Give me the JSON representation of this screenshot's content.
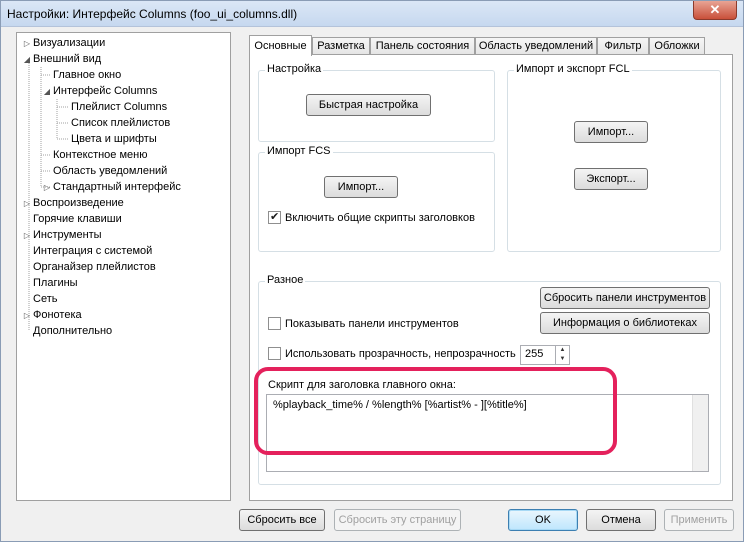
{
  "window": {
    "title": "Настройки: Интерфейс Columns (foo_ui_columns.dll)",
    "close_label": "✕"
  },
  "tree": {
    "items": [
      {
        "label": "Визуализации",
        "arrow": "▷"
      },
      {
        "label": "Внешний вид",
        "arrow": "◢"
      },
      {
        "label": "Главное окно",
        "arrow": ""
      },
      {
        "label": "Интерфейс Columns",
        "arrow": "◢"
      },
      {
        "label": "Плейлист Columns",
        "arrow": ""
      },
      {
        "label": "Список плейлистов",
        "arrow": ""
      },
      {
        "label": "Цвета и шрифты",
        "arrow": ""
      },
      {
        "label": "Контекстное меню",
        "arrow": ""
      },
      {
        "label": "Область уведомлений",
        "arrow": ""
      },
      {
        "label": "Стандартный интерфейс",
        "arrow": "▷"
      },
      {
        "label": "Воспроизведение",
        "arrow": "▷"
      },
      {
        "label": "Горячие клавиши",
        "arrow": ""
      },
      {
        "label": "Инструменты",
        "arrow": "▷"
      },
      {
        "label": "Интеграция с системой",
        "arrow": ""
      },
      {
        "label": "Органайзер плейлистов",
        "arrow": ""
      },
      {
        "label": "Плагины",
        "arrow": ""
      },
      {
        "label": "Сеть",
        "arrow": ""
      },
      {
        "label": "Фонотека",
        "arrow": "▷"
      },
      {
        "label": "Дополнительно",
        "arrow": ""
      }
    ]
  },
  "tabs": [
    {
      "label": "Основные"
    },
    {
      "label": "Разметка"
    },
    {
      "label": "Панель состояния"
    },
    {
      "label": "Область уведомлений"
    },
    {
      "label": "Фильтр"
    },
    {
      "label": "Обложки"
    }
  ],
  "setup_group": {
    "title": "Настройка",
    "quick_setup_button": "Быстрая настройка"
  },
  "fcl_group": {
    "title": "Импорт и экспорт FCL",
    "import_button": "Импорт...",
    "export_button": "Экспорт..."
  },
  "fcs_group": {
    "title": "Импорт FCS",
    "import_button": "Импорт...",
    "include_scripts_label": "Включить общие скрипты заголовков",
    "include_scripts_checked": true
  },
  "misc_group": {
    "title": "Разное",
    "reset_toolbars_button": "Сбросить панели инструментов",
    "library_info_button": "Информация о библиотеках",
    "show_toolbars_label": "Показывать панели инструментов",
    "show_toolbars_checked": false,
    "transparency_label": "Использовать прозрачность, непрозрачность",
    "transparency_checked": false,
    "opacity_value": "255",
    "title_script_label": "Скрипт для заголовка главного окна:",
    "title_script_value": "%playback_time% / %length% [%artist% - ][%title%]"
  },
  "footer": {
    "reset_all_button": "Сбросить все",
    "reset_page_button": "Сбросить эту страницу",
    "ok_button": "OK",
    "cancel_button": "Отмена",
    "apply_button": "Применить"
  },
  "colors": {
    "highlight": "#e4215c",
    "selection": "#3399ff"
  }
}
